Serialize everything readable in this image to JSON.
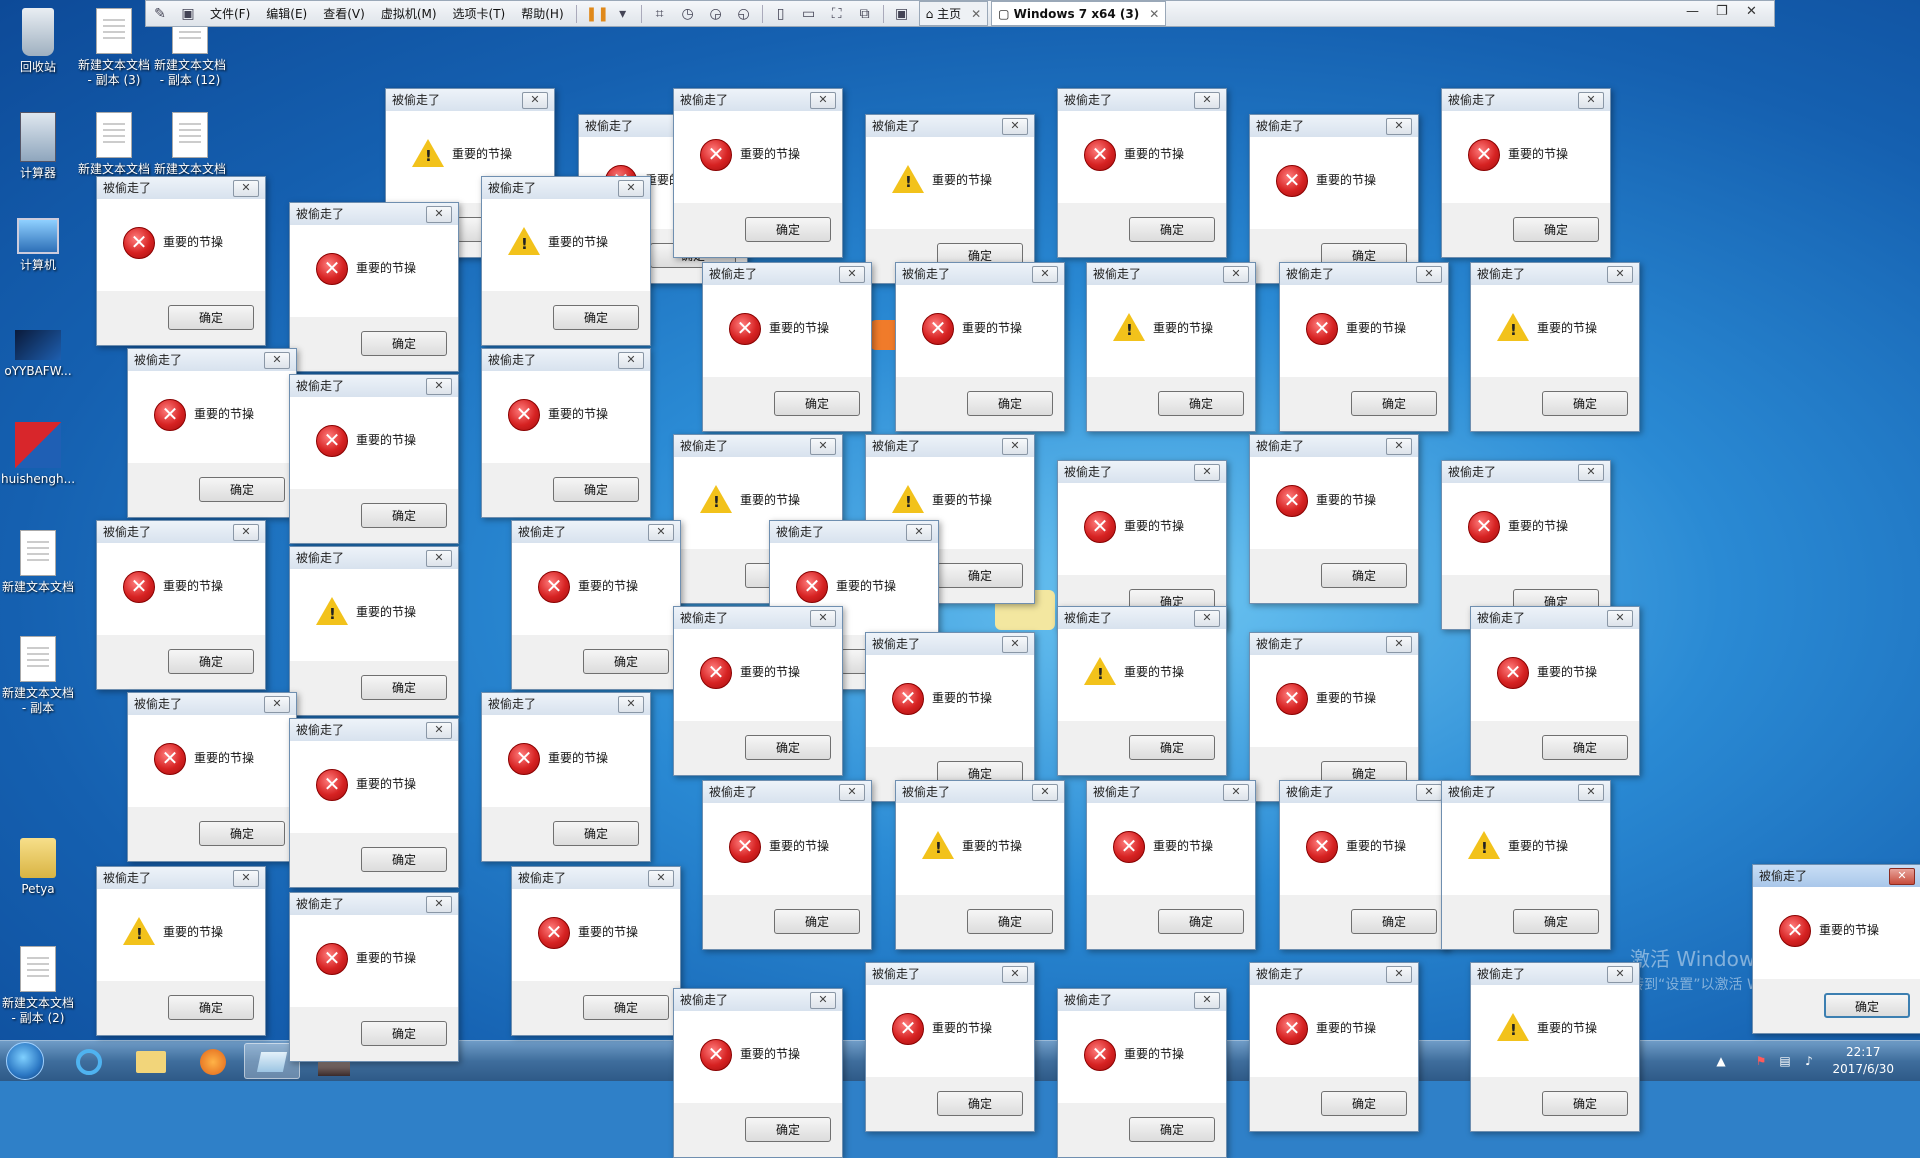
{
  "vm": {
    "menus": [
      "文件(F)",
      "编辑(E)",
      "查看(V)",
      "虚拟机(M)",
      "选项卡(T)",
      "帮助(H)"
    ],
    "tabs": [
      {
        "label": "主页"
      },
      {
        "label": "Windows 7 x64 (3)"
      }
    ]
  },
  "desktop_icons": [
    {
      "label": "回收站",
      "icon": "recycle-bin-icon"
    },
    {
      "label": "新建文本文档 - 副本 (3)",
      "icon": "text-document-icon"
    },
    {
      "label": "新建文本文档 - 副本 (12)",
      "icon": "text-document-icon"
    },
    {
      "label": "计算器",
      "icon": "calculator-icon"
    },
    {
      "label": "新建文本文档",
      "icon": "text-document-icon"
    },
    {
      "label": "新建文本文档",
      "icon": "text-document-icon"
    },
    {
      "label": "计算机",
      "icon": "computer-icon"
    },
    {
      "label": "oYYBAFW...",
      "icon": "image-file-icon"
    },
    {
      "label": "huishengh...",
      "icon": "app-shortcut-icon"
    },
    {
      "label": "新建文本文档",
      "icon": "text-document-icon"
    },
    {
      "label": "新建文本文档 - 副本",
      "icon": "text-document-icon"
    },
    {
      "label": "Petya",
      "icon": "folder-icon"
    },
    {
      "label": "新建文本文档 - 副本 (2)",
      "icon": "text-document-icon"
    }
  ],
  "dialog": {
    "title": "被偷走了",
    "message": "重要的节操",
    "ok_label": "确定",
    "close_symbol": "✕"
  },
  "watermark": {
    "line1": "激活 Windows",
    "line2": "转到“设置”以激活 Windows。"
  },
  "taskbar": {
    "time": "22:17",
    "date": "2017/6/30"
  },
  "colors": {
    "wallpaper": "#1f78c8",
    "error_icon": "#d62222",
    "warning_icon": "#f2c21b",
    "dialog_bg": "#f0f0f0"
  }
}
